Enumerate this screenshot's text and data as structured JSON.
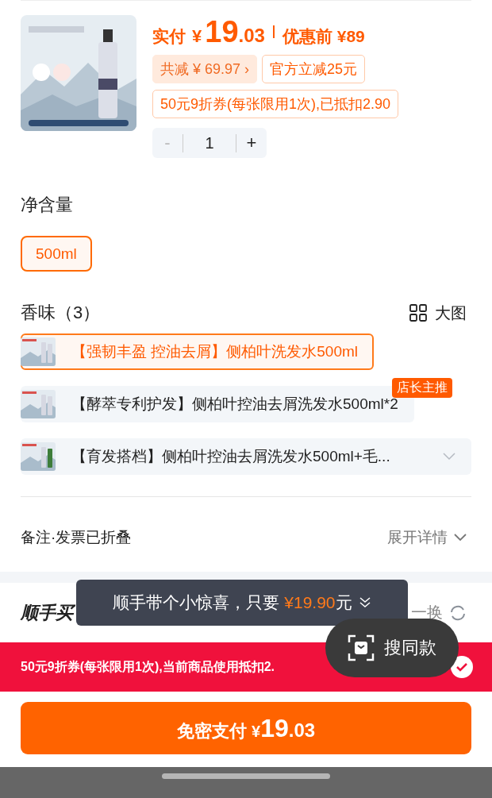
{
  "product": {
    "price_label": "实付",
    "currency": "¥",
    "price_integer": "19",
    "price_decimal": ".03",
    "original_price": "优惠前 ¥89",
    "total_discount": "共减 ¥ 69.97",
    "total_discount_chevron": "›",
    "official_discount": "官方立减25元",
    "coupon": "50元9折券(每张限用1次),已抵扣2.90",
    "stepper": {
      "minus": "-",
      "quantity": "1",
      "plus": "+",
      "minus_disabled": true
    }
  },
  "size": {
    "title": "净含量",
    "options": [
      {
        "label": "500ml",
        "selected": true
      }
    ]
  },
  "scent": {
    "title": "香味（3）",
    "view_toggle": "大图",
    "options": [
      {
        "label": "【强韧丰盈 控油去屑】侧柏叶洗发水500ml",
        "selected": true,
        "expandable": false
      },
      {
        "label": "【酵萃专利护发】侧柏叶控油去屑洗发水500ml*2",
        "selected": false,
        "expandable": false,
        "badge": "店长主推"
      },
      {
        "label": "【育发搭档】侧柏叶控油去屑洗发水500ml+毛...",
        "selected": false,
        "expandable": true
      }
    ]
  },
  "remarks": {
    "label": "备注·发票已折叠",
    "action": "展开详情"
  },
  "addon": {
    "title": "顺手买",
    "refresh": "一换"
  },
  "toast": {
    "text": "顺手带个小惊喜，只要",
    "price": "¥19.90",
    "unit": "元"
  },
  "floating_button": {
    "label": "搜同款"
  },
  "coupon_banner": {
    "text": "50元9折券(每张限用1次),当前商品使用抵扣2.",
    "checked": true
  },
  "pay_button": {
    "label": "免密支付",
    "currency": "¥",
    "integer": "19",
    "decimal": ".03"
  }
}
